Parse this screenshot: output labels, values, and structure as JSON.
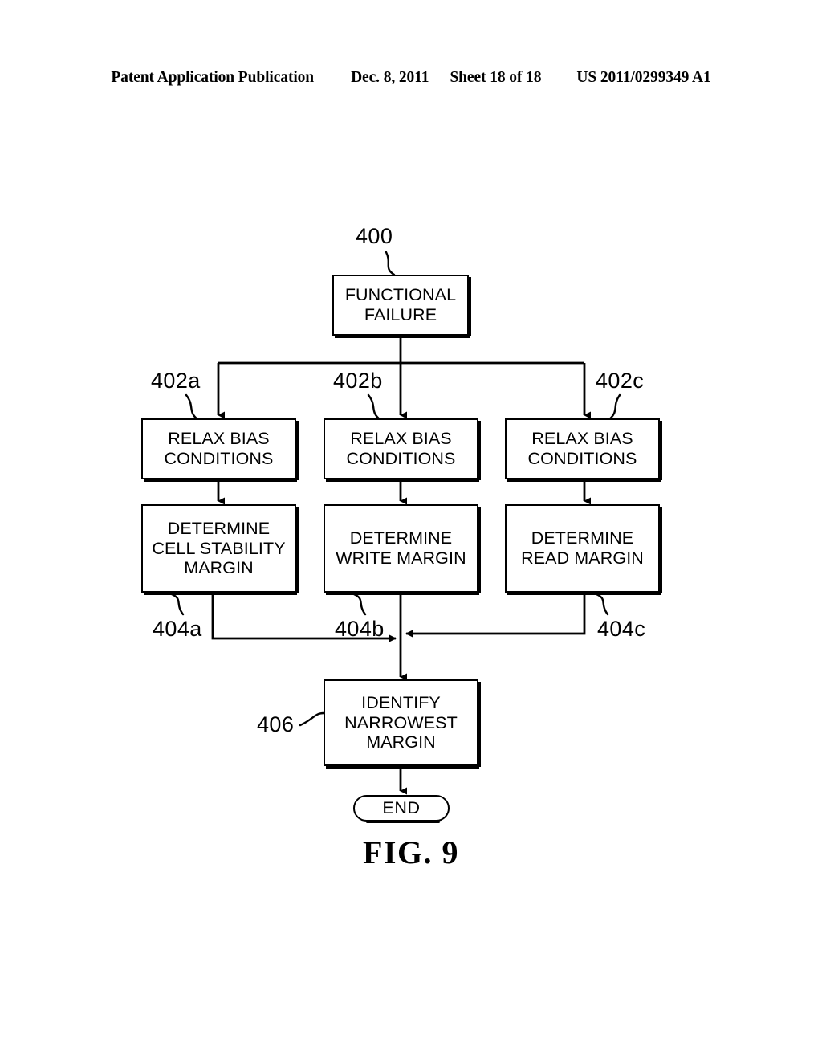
{
  "header": {
    "publication": "Patent Application Publication",
    "date": "Dec. 8, 2011",
    "sheet": "Sheet 18 of 18",
    "publication_number": "US 2011/0299349 A1"
  },
  "figure": {
    "caption": "FIG. 9",
    "stroke_color": "#000000",
    "background_color": "#ffffff"
  },
  "flowchart": {
    "nodes": [
      {
        "id": "400",
        "ref": "400",
        "label": "FUNCTIONAL\nFAILURE",
        "shape": "process"
      },
      {
        "id": "402a",
        "ref": "402a",
        "label": "RELAX BIAS\nCONDITIONS",
        "shape": "process"
      },
      {
        "id": "402b",
        "ref": "402b",
        "label": "RELAX BIAS\nCONDITIONS",
        "shape": "process"
      },
      {
        "id": "402c",
        "ref": "402c",
        "label": "RELAX BIAS\nCONDITIONS",
        "shape": "process"
      },
      {
        "id": "404a",
        "ref": "404a",
        "label": "DETERMINE\nCELL STABILITY\nMARGIN",
        "shape": "process"
      },
      {
        "id": "404b",
        "ref": "404b",
        "label": "DETERMINE\nWRITE MARGIN",
        "shape": "process"
      },
      {
        "id": "404c",
        "ref": "404c",
        "label": "DETERMINE\nREAD MARGIN",
        "shape": "process"
      },
      {
        "id": "406",
        "ref": "406",
        "label": "IDENTIFY\nNARROWEST\nMARGIN",
        "shape": "process"
      },
      {
        "id": "end",
        "ref": "",
        "label": "END",
        "shape": "terminator"
      }
    ],
    "edges": [
      {
        "from": "400",
        "to": "402a",
        "type": "split-branch"
      },
      {
        "from": "400",
        "to": "402b",
        "type": "straight"
      },
      {
        "from": "400",
        "to": "402c",
        "type": "split-branch"
      },
      {
        "from": "402a",
        "to": "404a",
        "type": "straight"
      },
      {
        "from": "402b",
        "to": "404b",
        "type": "straight"
      },
      {
        "from": "402c",
        "to": "404c",
        "type": "straight"
      },
      {
        "from": "404a",
        "to": "406",
        "type": "merge-branch"
      },
      {
        "from": "404b",
        "to": "406",
        "type": "straight"
      },
      {
        "from": "404c",
        "to": "406",
        "type": "merge-branch"
      },
      {
        "from": "406",
        "to": "end",
        "type": "straight"
      }
    ]
  }
}
